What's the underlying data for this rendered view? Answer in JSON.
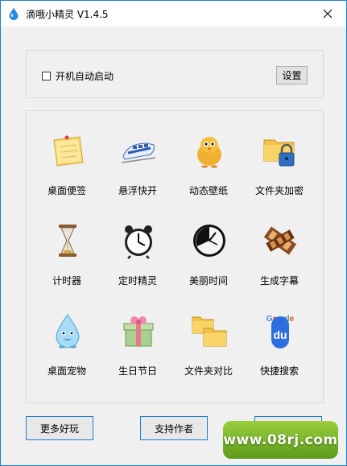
{
  "window": {
    "title": "滴哦小精灵 V1.4.5"
  },
  "settings_panel": {
    "autostart_label": "开机自动启动",
    "autostart_checked": false,
    "settings_button": "设置"
  },
  "tools": [
    {
      "label": "桌面便签",
      "icon": "sticky-note-icon"
    },
    {
      "label": "悬浮快开",
      "icon": "bullet-train-icon"
    },
    {
      "label": "动态壁纸",
      "icon": "chick-icon"
    },
    {
      "label": "文件夹加密",
      "icon": "folder-lock-icon"
    },
    {
      "label": "计时器",
      "icon": "hourglass-icon"
    },
    {
      "label": "定时精灵",
      "icon": "alarm-clock-icon"
    },
    {
      "label": "美丽时间",
      "icon": "clock-face-icon"
    },
    {
      "label": "生成字幕",
      "icon": "film-strip-icon"
    },
    {
      "label": "桌面宠物",
      "icon": "water-drop-pet-icon"
    },
    {
      "label": "生日节日",
      "icon": "gift-box-icon"
    },
    {
      "label": "文件夹对比",
      "icon": "folders-compare-icon"
    },
    {
      "label": "快捷搜索",
      "icon": "google-baidu-icon"
    }
  ],
  "bottom": {
    "more_fun": "更多好玩",
    "support_author": "支持作者"
  },
  "watermark": "www.08rj.com",
  "colors": {
    "accent": "#1e7ed6",
    "watermark": "#6fb02a"
  }
}
